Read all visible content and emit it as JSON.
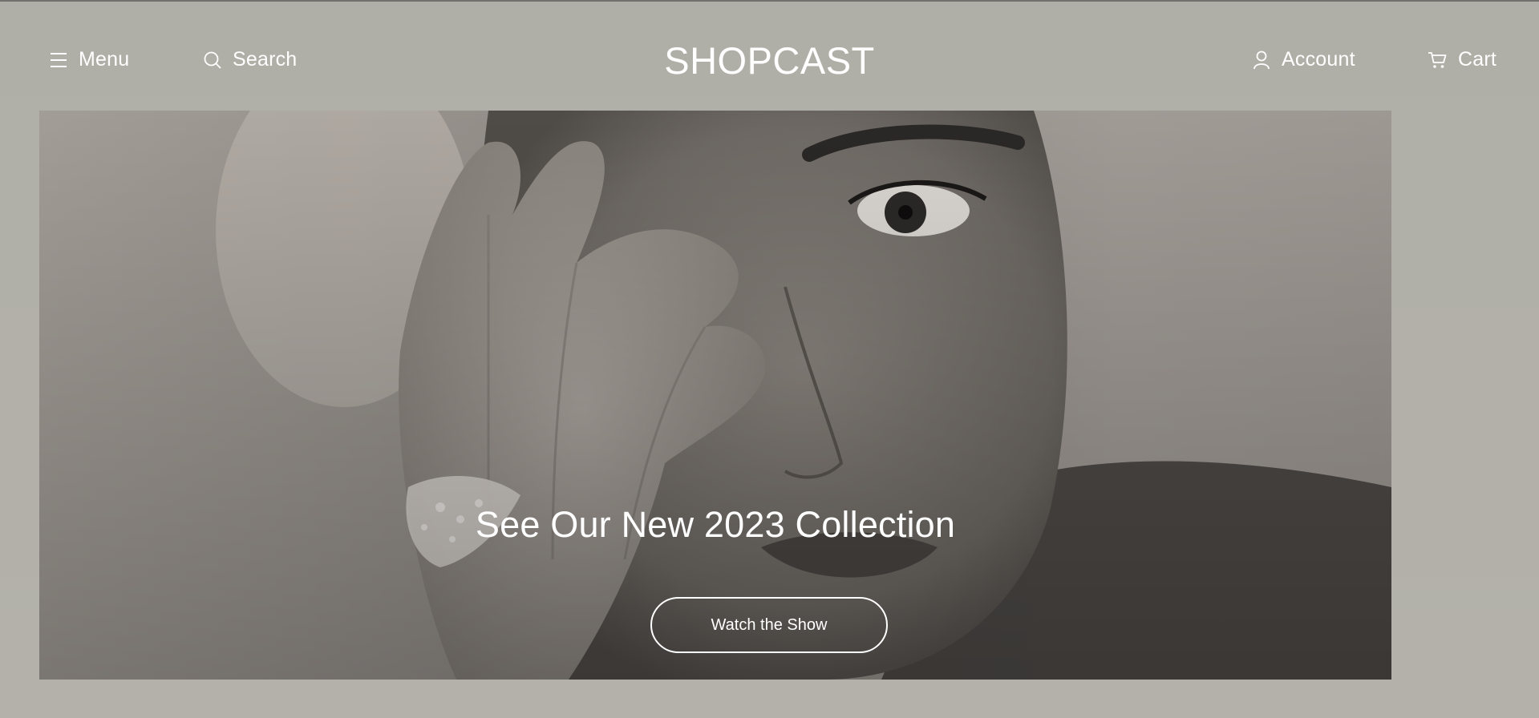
{
  "header": {
    "menu_label": "Menu",
    "search_label": "Search",
    "brand": "SHOPCAST",
    "account_label": "Account",
    "cart_label": "Cart"
  },
  "hero": {
    "title": "See Our New 2023 Collection",
    "button_label": "Watch the Show",
    "image_subject": "black-and-white portrait of a woman covering one eye with her hand, wearing a diamond ring"
  },
  "colors": {
    "page_background": "#b1b0a8",
    "text": "#ffffff",
    "hero_tone": "#9d9893"
  },
  "icons": {
    "menu": "hamburger-icon",
    "search": "search-icon",
    "account": "user-icon",
    "cart": "cart-icon"
  }
}
